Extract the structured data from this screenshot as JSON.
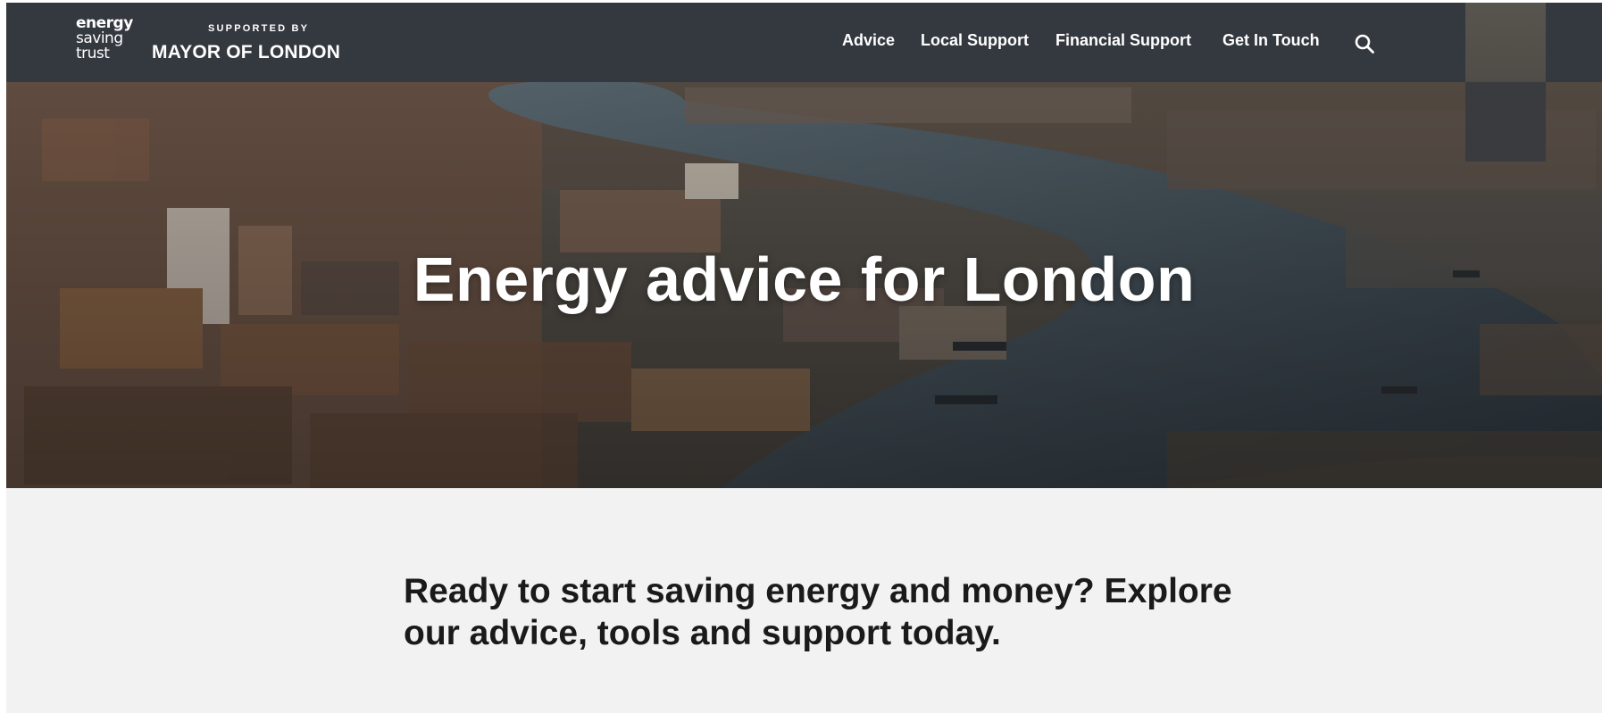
{
  "brand": {
    "logo_lines": [
      "energy",
      "saving",
      "trust"
    ],
    "supported_by": "SUPPORTED BY",
    "partner": "MAYOR OF LONDON"
  },
  "nav": {
    "items": [
      {
        "label": "Advice"
      },
      {
        "label": "Local Support"
      },
      {
        "label": "Financial Support"
      },
      {
        "label": "Get In Touch"
      }
    ],
    "search_icon": "search-icon"
  },
  "hero": {
    "title": "Energy advice for London",
    "image": "aerial view of London and the River Thames"
  },
  "intro": {
    "text": "Ready to start saving energy and money? Explore our advice, tools and support today."
  },
  "colors": {
    "header_bg": "#34383f",
    "page_bg": "#f2f2f2",
    "text_dark": "#1a1a1a",
    "text_light": "#ffffff"
  }
}
